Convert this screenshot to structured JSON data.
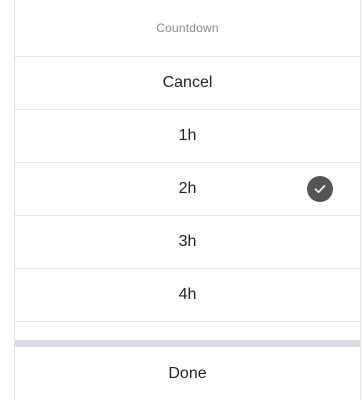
{
  "picker": {
    "title": "Countdown",
    "cancel_label": "Cancel",
    "options": [
      {
        "label": "1h",
        "selected": false
      },
      {
        "label": "2h",
        "selected": true
      },
      {
        "label": "3h",
        "selected": false
      },
      {
        "label": "4h",
        "selected": false
      }
    ],
    "done_label": "Done",
    "selected_icon": "check-circle-icon"
  },
  "colors": {
    "check_fill": "#555555",
    "divider_band": "#dcdbe6",
    "title_text": "#8a8a8a",
    "option_text": "#222222"
  }
}
